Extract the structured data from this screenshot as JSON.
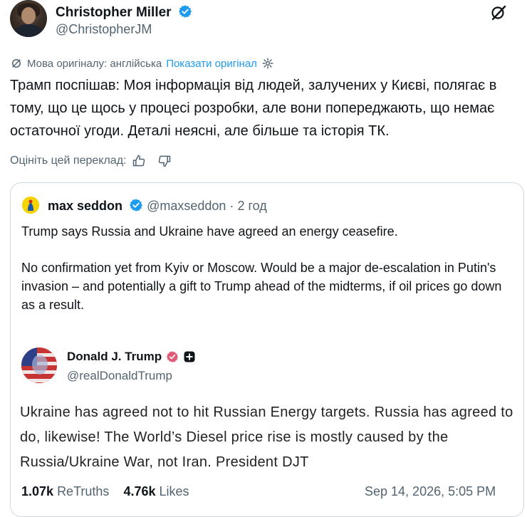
{
  "tweet": {
    "author_name": "Christopher Miller",
    "author_handle": "@ChristopherJM",
    "original_language_label": "Мова оригіналу: англійська",
    "show_original_label": "Показати оригінал",
    "text": "Трамп поспішав: Моя інформація від людей, залучених у Києві, полягає в тому, що це щось у процесі розробки, але вони попереджають, що немає остаточної угоди. Деталі неясні, але більше та історія ТК.",
    "rate_translation_label": "Оцініть цей переклад:"
  },
  "quote": {
    "author_name": "max seddon",
    "author_handle": "@maxseddon",
    "separator": "·",
    "time": "2 год",
    "paragraph1": "Trump says Russia and Ukraine have agreed an energy ceasefire.",
    "paragraph2": "No confirmation yet from Kyiv or Moscow. Would be a major de-escalation in Putin's invasion – and potentially a gift to Trump ahead of the midterms, if oil prices go down as a result."
  },
  "embedded_post": {
    "author_name": "Donald J. Trump",
    "author_handle": "@realDonaldTrump",
    "text": "Ukraine has agreed not to hit Russian Energy targets. Russia has agreed to do, likewise! The World’s Diesel price rise is mostly caused by the Russia/Ukraine War, not Iran. President DJT",
    "retruths_count": "1.07k",
    "retruths_label": "ReTruths",
    "likes_count": "4.76k",
    "likes_label": "Likes",
    "date": "Sep 14, 2026, 5:05 PM"
  },
  "colors": {
    "link": "#1d9bf0",
    "verified": "#1d9bf0",
    "secondary_text": "#536471",
    "border": "#cfd9de",
    "truth_badge": "#e05a78"
  },
  "icons": [
    "verified-badge-icon",
    "grok-icon",
    "translate-icon",
    "gear-icon",
    "thumbs-up-icon",
    "thumbs-down-icon",
    "plus-icon"
  ]
}
